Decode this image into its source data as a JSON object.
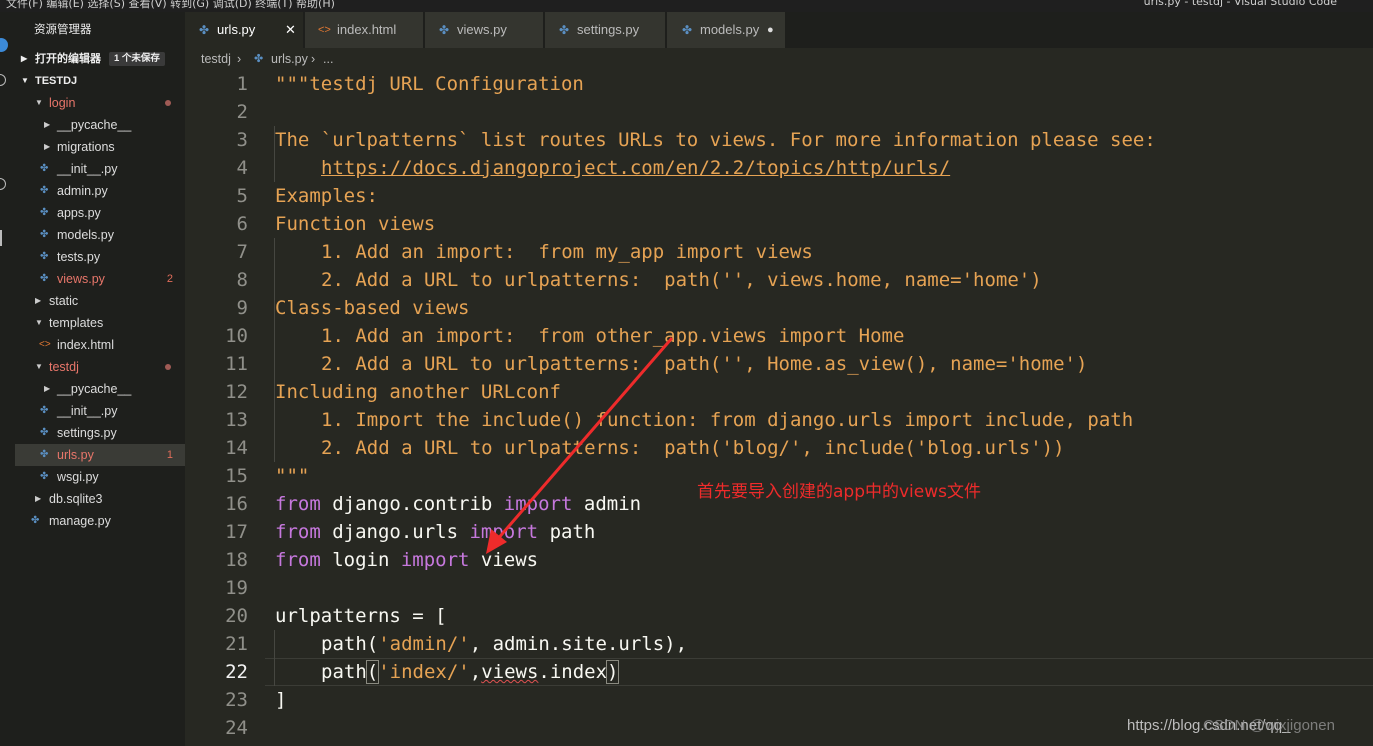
{
  "menubar": {
    "menus": "文件(F)   编辑(E)   选择(S)   查看(V)   转到(G)   调试(D)   终端(T)   帮助(H)",
    "window_title": "urls.py - testdj - Visual Studio Code"
  },
  "sidebar": {
    "title": "资源管理器",
    "open_editors": {
      "label": "打开的编辑器",
      "badge": "1 个未保存"
    },
    "project": {
      "label": "TESTDJ"
    },
    "items": [
      {
        "name": "login",
        "kind": "folder",
        "state": "open",
        "status": "dot"
      },
      {
        "name": "__pycache__",
        "kind": "folder",
        "state": "closed"
      },
      {
        "name": "migrations",
        "kind": "folder",
        "state": "closed"
      },
      {
        "name": "__init__.py",
        "kind": "py"
      },
      {
        "name": "admin.py",
        "kind": "py"
      },
      {
        "name": "apps.py",
        "kind": "py"
      },
      {
        "name": "models.py",
        "kind": "py"
      },
      {
        "name": "tests.py",
        "kind": "py"
      },
      {
        "name": "views.py",
        "kind": "py",
        "count": "2"
      },
      {
        "name": "static",
        "kind": "folder",
        "state": "closed"
      },
      {
        "name": "templates",
        "kind": "folder",
        "state": "open"
      },
      {
        "name": "index.html",
        "kind": "html"
      },
      {
        "name": "testdj",
        "kind": "folder",
        "state": "open",
        "status": "dot"
      },
      {
        "name": "__pycache__",
        "kind": "folder",
        "state": "closed"
      },
      {
        "name": "__init__.py",
        "kind": "py"
      },
      {
        "name": "settings.py",
        "kind": "py"
      },
      {
        "name": "urls.py",
        "kind": "py",
        "count": "1"
      },
      {
        "name": "wsgi.py",
        "kind": "py"
      },
      {
        "name": "db.sqlite3",
        "kind": "file",
        "state": "closed"
      },
      {
        "name": "manage.py",
        "kind": "py"
      }
    ]
  },
  "tabs": [
    {
      "label": "urls.py",
      "active": true,
      "close": "✕"
    },
    {
      "label": "index.html"
    },
    {
      "label": "views.py"
    },
    {
      "label": "settings.py"
    },
    {
      "label": "models.py",
      "dirty": "●"
    }
  ],
  "breadcrumb": {
    "folder": "testdj",
    "file": "urls.py",
    "rest": "..."
  },
  "editor": {
    "current_line": "22",
    "lines": [
      "1",
      "2",
      "3",
      "4",
      "5",
      "6",
      "7",
      "8",
      "9",
      "10",
      "11",
      "12",
      "13",
      "14",
      "15",
      "16",
      "17",
      "18",
      "19",
      "20",
      "21",
      "22",
      "23",
      "24"
    ],
    "code": {
      "l1": "\"\"\"testdj URL Configuration",
      "l3": "The `urlpatterns` list routes URLs to views. For more information please see:",
      "l4_url": "https://docs.djangoproject.com/en/2.2/topics/http/urls/",
      "l5": "Examples:",
      "l6": "Function views",
      "l7": "1. Add an import:  from my_app import views",
      "l8": "2. Add a URL to urlpatterns:  path('', views.home, name='home')",
      "l9": "Class-based views",
      "l10": "1. Add an import:  from other_app.views import Home",
      "l11": "2. Add a URL to urlpatterns:  path('', Home.as_view(), name='home')",
      "l12": "Including another URLconf",
      "l13": "1. Import the include() function: from django.urls import include, path",
      "l14": "2. Add a URL to urlpatterns:  path('blog/', include('blog.urls'))",
      "l15": "\"\"\"",
      "from": "from",
      "import": "import",
      "l16_mod": " django.contrib ",
      "l16_name": " admin",
      "l17_mod": " django.urls ",
      "l17_name": " path",
      "l18_mod": " login ",
      "l18_name": " views",
      "l20": "urlpatterns = [",
      "l21_a": "path(",
      "l21_s": "'admin/'",
      "l21_b": ", admin.site.urls),",
      "l22_a": "path",
      "l22_o": "(",
      "l22_s": "'index/'",
      "l22_c": ",",
      "l22_v": "views",
      "l22_d": ".index",
      "l22_e": ")",
      "l23": "]"
    }
  },
  "annotation": {
    "text": "首先要导入创建的app中的views文件",
    "color": "#ee2b2b"
  },
  "watermark": {
    "text": "https://blog.csdn.net/qq_",
    "text2": "CSDN @wjxjigonen"
  }
}
